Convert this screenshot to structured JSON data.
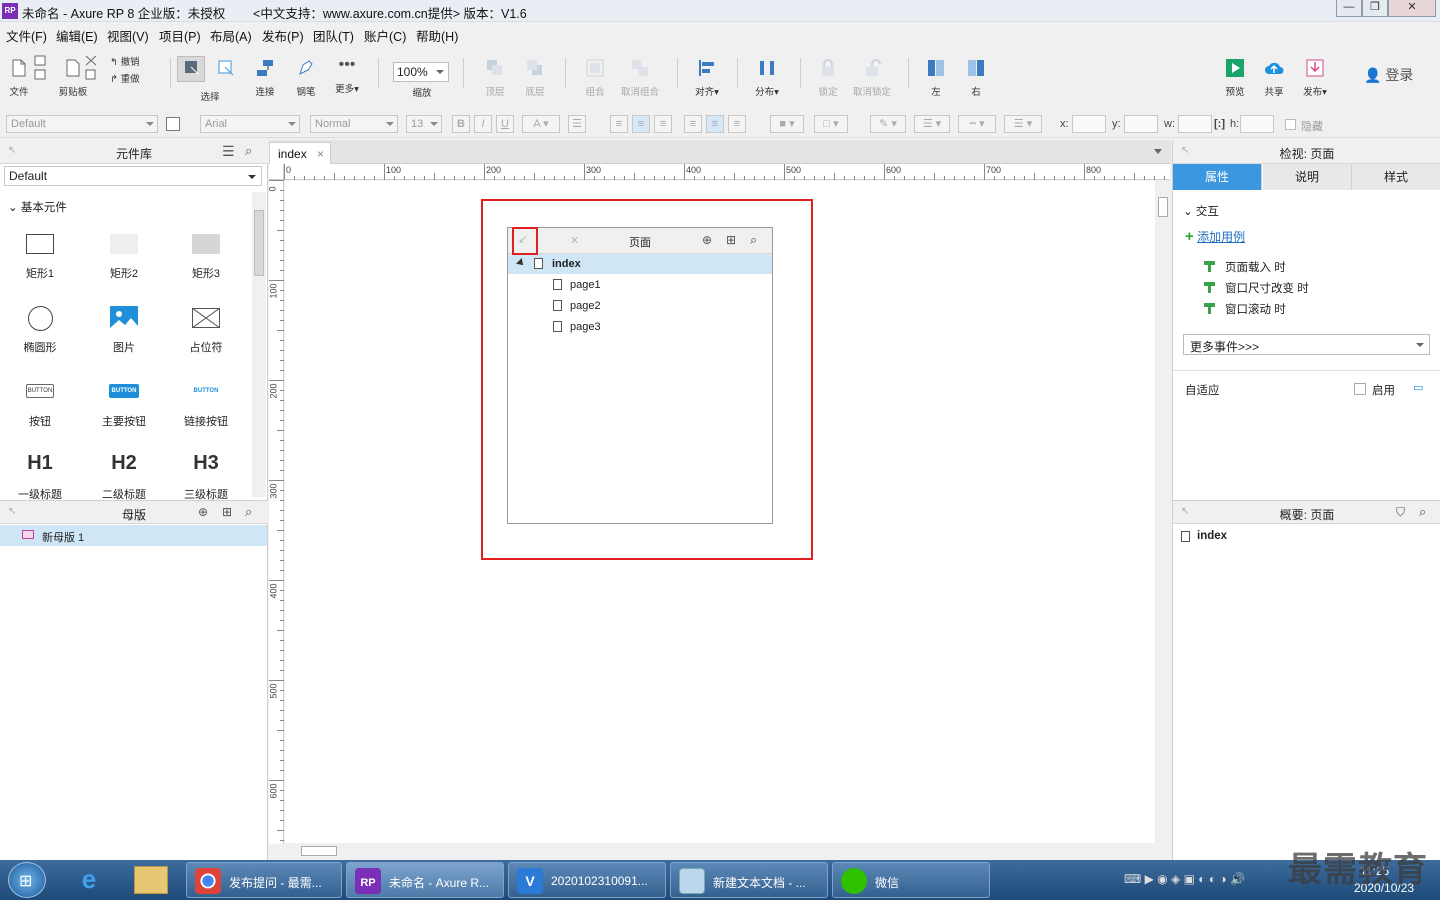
{
  "window": {
    "title": "未命名 - Axure RP 8 企业版：未授权        <中文支持：www.axure.com.cn提供> 版本：V1.6",
    "logo_text": "RP",
    "controls": {
      "minimize": "—",
      "maximize": "❐",
      "close": "✕"
    }
  },
  "menu": [
    "文件(F)",
    "编辑(E)",
    "视图(V)",
    "项目(P)",
    "布局(A)",
    "发布(P)",
    "团队(T)",
    "账户(C)",
    "帮助(H)"
  ],
  "toolbar": {
    "file": "文件",
    "clipboard": "剪贴板",
    "undo": "撤销",
    "redo": "重做",
    "select": "选择",
    "connect": "连接",
    "pen": "钢笔",
    "more": "更多▾",
    "zoom_value": "100%",
    "zoom": "缩放",
    "top": "顶层",
    "bottom": "底层",
    "group": "组合",
    "ungroup": "取消组合",
    "align": "对齐▾",
    "distribute": "分布▾",
    "lock": "锁定",
    "unlock": "取消锁定",
    "left": "左",
    "right": "右",
    "preview": "预览",
    "share": "共享",
    "publish": "发布▾",
    "login": "登录"
  },
  "format": {
    "style": "Default",
    "font": "Arial",
    "weight": "Normal",
    "size": "13",
    "x_label": "x:",
    "y_label": "y:",
    "w_label": "w:",
    "h_label": "h:",
    "hidden": "隐藏"
  },
  "library": {
    "title": "元件库",
    "selected": "Default",
    "section": "基本元件",
    "widgets": [
      "矩形1",
      "矩形2",
      "矩形3",
      "椭圆形",
      "图片",
      "占位符",
      "按钮",
      "主要按钮",
      "链接按钮",
      "一级标题",
      "二级标题",
      "三级标题"
    ],
    "button_text": "BUTTON",
    "headings": [
      "H1",
      "H2",
      "H3"
    ]
  },
  "masters": {
    "title": "母版",
    "items": [
      "新母版 1"
    ]
  },
  "canvas": {
    "tab": "index",
    "tab_close": "×",
    "ruler_h": [
      "0",
      "100",
      "200",
      "300",
      "400",
      "500",
      "600",
      "700",
      "800"
    ],
    "ruler_v": [
      "0",
      "100",
      "200",
      "300",
      "400",
      "500",
      "600"
    ]
  },
  "pages_panel": {
    "title": "页面",
    "root": "index",
    "children": [
      "page1",
      "page2",
      "page3"
    ]
  },
  "inspector": {
    "title": "检视: 页面",
    "tabs": [
      "属性",
      "说明",
      "样式"
    ],
    "interaction": "交互",
    "add_case": "添加用例",
    "events": [
      "页面载入 时",
      "窗口尺寸改变 时",
      "窗口滚动 时"
    ],
    "more_events": "更多事件>>>",
    "adaptive": "自适应",
    "enable": "启用"
  },
  "outline": {
    "title": "概要: 页面",
    "item": "index"
  },
  "taskbar": {
    "items": [
      "发布提问 - 最需...",
      "未命名 - Axure R...",
      "2020102310091...",
      "新建文本文档 - ...",
      "微信"
    ],
    "time": "11:25",
    "date": "2020/10/23",
    "watermark": "最需教育"
  },
  "colors": {
    "accent": "#3b97e0",
    "highlight_red": "#e02020",
    "selected_row": "#cfe6f7",
    "taskbar": "#2a5a8c"
  }
}
